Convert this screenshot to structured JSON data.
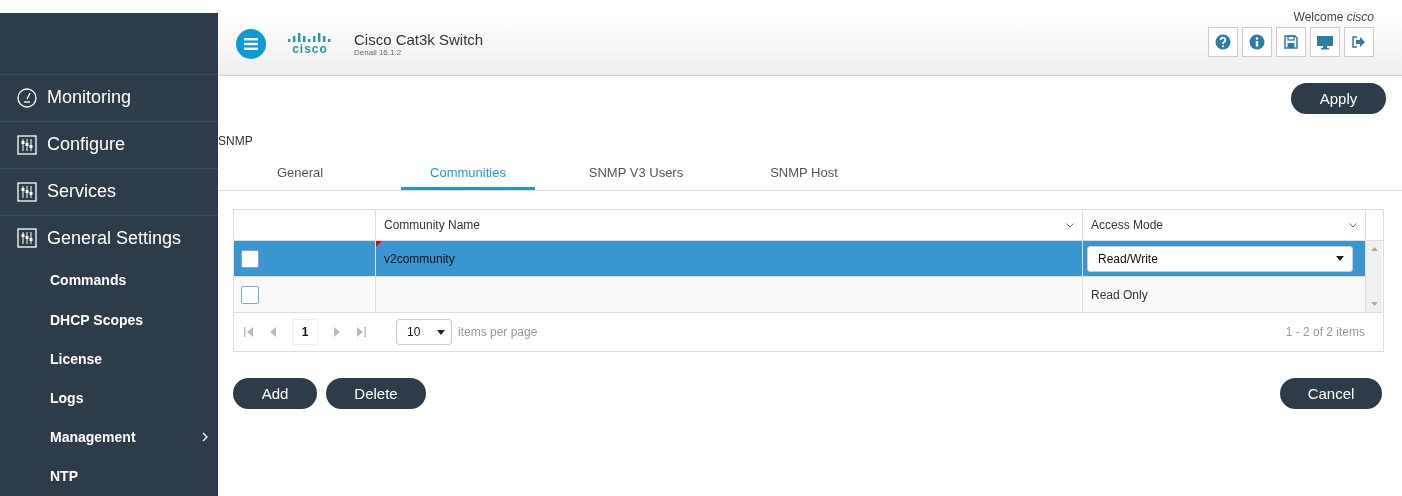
{
  "header": {
    "logo": "cisco",
    "title": "Cisco Cat3k Switch",
    "subtitle": "Denali 16.1.2",
    "welcome": "Welcome",
    "user": "cisco"
  },
  "sidebar": {
    "items": [
      {
        "label": "Monitoring",
        "kind": "gauge"
      },
      {
        "label": "Configure",
        "kind": "sliders"
      },
      {
        "label": "Services",
        "kind": "sliders"
      },
      {
        "label": "General Settings",
        "kind": "sliders",
        "children": [
          {
            "label": "Commands",
            "has_submenu": false
          },
          {
            "label": "DHCP Scopes",
            "has_submenu": false
          },
          {
            "label": "License",
            "has_submenu": false
          },
          {
            "label": "Logs",
            "has_submenu": false
          },
          {
            "label": "Management",
            "has_submenu": true
          },
          {
            "label": "NTP",
            "has_submenu": false
          }
        ]
      }
    ]
  },
  "apply_button": "Apply",
  "section_title": "SNMP",
  "tabs": [
    {
      "label": "General",
      "selected": false
    },
    {
      "label": "Communities",
      "selected": true
    },
    {
      "label": "SNMP V3 Users",
      "selected": false
    },
    {
      "label": "SNMP Host",
      "selected": false
    }
  ],
  "table": {
    "columns": [
      "Community Name",
      "Access Mode"
    ],
    "rows": [
      {
        "selected": true,
        "checked": false,
        "community_name": "v2community",
        "modified": true,
        "access_mode": "Read/Write",
        "kind": "dropdown"
      },
      {
        "selected": false,
        "checked": false,
        "modified": false,
        "access_mode": "Read Only",
        "kind": "text"
      }
    ],
    "pager": {
      "page": "1",
      "page_size": "10",
      "page_size_label": "items per page",
      "summary": "1 - 2 of 2 items"
    }
  },
  "buttons": [
    "Add",
    "Delete"
  ],
  "cancel_button": "Cancel"
}
